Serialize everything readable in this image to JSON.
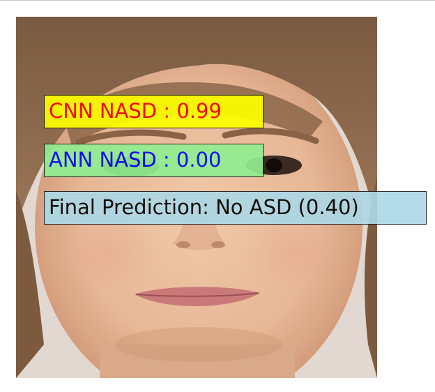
{
  "labels": {
    "cnn": {
      "text": "CNN NASD : 0.99",
      "text_color": "#ff0000",
      "bg_color": "#ffff00"
    },
    "ann": {
      "text": "ANN NASD : 0.00",
      "text_color": "#0000ff",
      "bg_color": "#90ee90"
    },
    "final": {
      "text": "Final Prediction: No ASD (0.40)",
      "text_color": "#000000",
      "bg_color": "#add8e6"
    }
  }
}
